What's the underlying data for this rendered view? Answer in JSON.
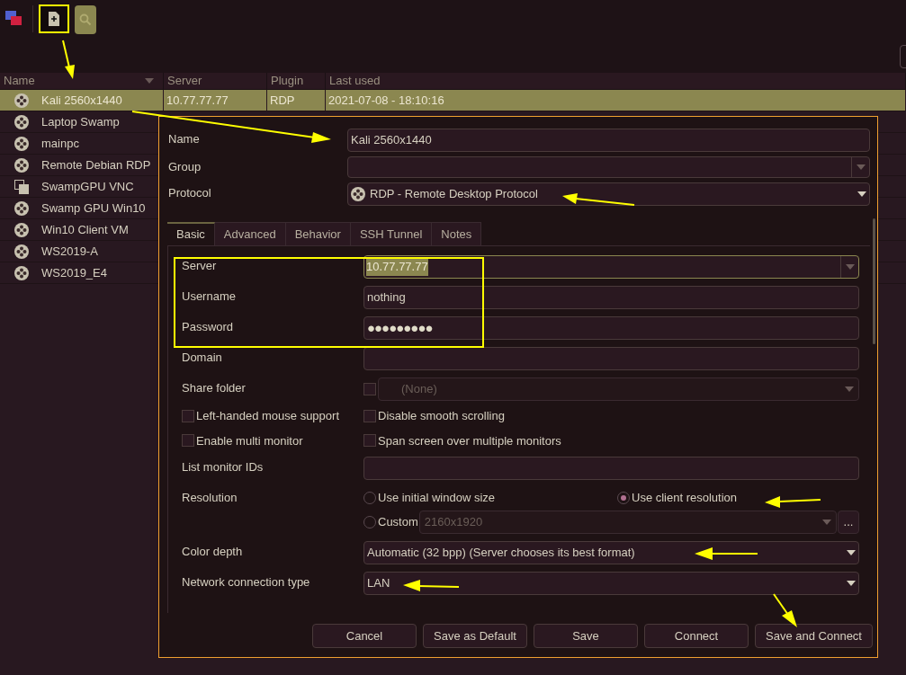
{
  "list": {
    "columns": [
      {
        "label": "Name",
        "sorted": true
      },
      {
        "label": "Server",
        "sorted": false
      },
      {
        "label": "Plugin",
        "sorted": false
      },
      {
        "label": "Last used",
        "sorted": false
      }
    ],
    "rows": [
      {
        "name": "Kali 2560x1440",
        "server": "10.77.77.77",
        "plugin": "RDP",
        "last_used": "2021-07-08 - 18:10:16",
        "kind": "rdp",
        "selected": true
      },
      {
        "name": "Laptop Swamp",
        "kind": "rdp",
        "selected": false
      },
      {
        "name": "mainpc",
        "kind": "rdp",
        "selected": false
      },
      {
        "name": "Remote Debian RDP",
        "kind": "rdp",
        "selected": false
      },
      {
        "name": "SwampGPU VNC",
        "kind": "vnc",
        "selected": false
      },
      {
        "name": "Swamp GPU Win10",
        "kind": "rdp",
        "selected": false
      },
      {
        "name": "Win10 Client VM",
        "kind": "rdp",
        "selected": false
      },
      {
        "name": "WS2019-A",
        "kind": "rdp",
        "selected": false
      },
      {
        "name": "WS2019_E4",
        "kind": "rdp",
        "selected": false
      }
    ]
  },
  "dialog": {
    "name": {
      "label": "Name",
      "value": "Kali 2560x1440"
    },
    "group": {
      "label": "Group"
    },
    "protocol": {
      "label": "Protocol",
      "value": "RDP - Remote Desktop Protocol"
    },
    "tabs": [
      {
        "label": "Basic",
        "selected": true
      },
      {
        "label": "Advanced",
        "selected": false
      },
      {
        "label": "Behavior",
        "selected": false
      },
      {
        "label": "SSH Tunnel",
        "selected": false
      },
      {
        "label": "Notes",
        "selected": false
      }
    ],
    "server": {
      "label": "Server",
      "value": "10.77.77.77",
      "text_selected": true
    },
    "username": {
      "label": "Username",
      "value": "nothing"
    },
    "password": {
      "label": "Password",
      "value": "●●●●●●●●●"
    },
    "domain": {
      "label": "Domain"
    },
    "share_folder": {
      "label": "Share folder",
      "checked": false,
      "value": "(None)"
    },
    "checkboxes": [
      {
        "label": "Left-handed mouse support",
        "checked": false
      },
      {
        "label": "Disable smooth scrolling",
        "checked": false
      },
      {
        "label": "Enable multi monitor",
        "checked": false
      },
      {
        "label": "Span screen over multiple monitors",
        "checked": false
      }
    ],
    "monitor_ids": {
      "label": "List monitor IDs"
    },
    "resolution": {
      "label": "Resolution",
      "options": [
        {
          "label": "Use initial window size",
          "selected": false
        },
        {
          "label": "Use client resolution",
          "selected": true
        },
        {
          "label": "Custom",
          "selected": false
        }
      ],
      "custom_value": "2160x1920",
      "more_button": "..."
    },
    "color_depth": {
      "label": "Color depth",
      "value": "Automatic (32 bpp) (Server chooses its best format)"
    },
    "network": {
      "label": "Network connection type",
      "value": "LAN"
    },
    "buttons": [
      "Cancel",
      "Save as Default",
      "Save",
      "Connect",
      "Save and Connect"
    ]
  }
}
